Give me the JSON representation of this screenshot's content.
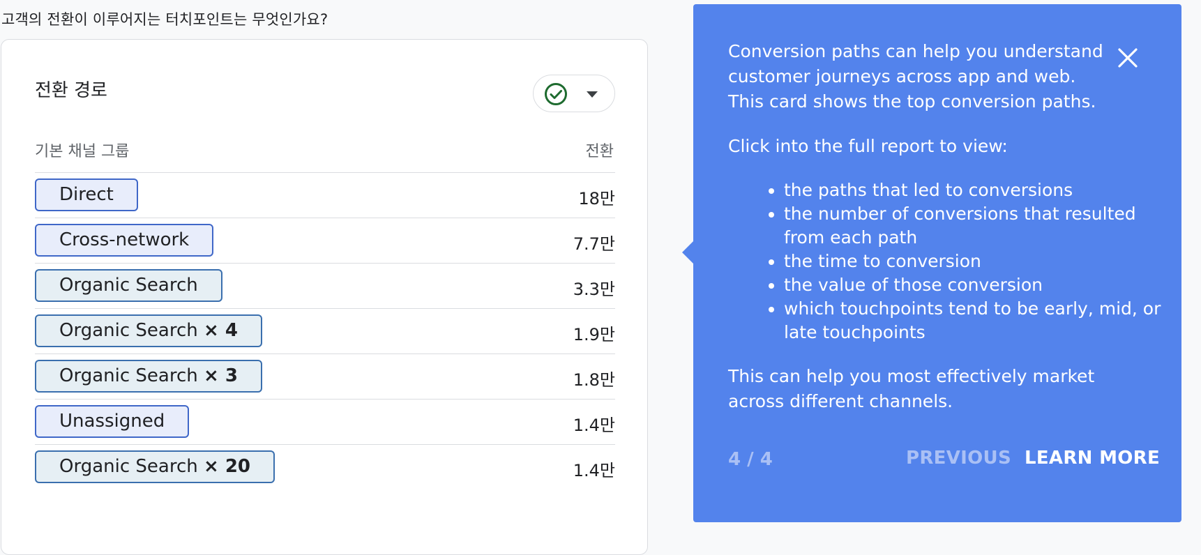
{
  "question": "고객의 전환이 이루어지는 터치포인트는 무엇인가요?",
  "card": {
    "title": "전환 경로",
    "status_icon": "check-circle-icon",
    "dropdown_icon": "caret-down-icon",
    "column_left": "기본 채널 그룹",
    "column_right": "전환",
    "rows": [
      {
        "label": "Direct",
        "mult": "",
        "value": "18만"
      },
      {
        "label": "Cross-network",
        "mult": "",
        "value": "7.7만"
      },
      {
        "label": "Organic Search",
        "mult": "",
        "value": "3.3만"
      },
      {
        "label": "Organic Search",
        "mult": "× 4",
        "value": "1.9만"
      },
      {
        "label": "Organic Search",
        "mult": "× 3",
        "value": "1.8만"
      },
      {
        "label": "Unassigned",
        "mult": "",
        "value": "1.4만"
      },
      {
        "label": "Organic Search",
        "mult": "× 20",
        "value": "1.4만"
      }
    ]
  },
  "tooltip": {
    "intro_1": "Conversion paths can help you understand",
    "intro_2": "customer journeys across app and web.",
    "intro_3": "This card shows the top conversion paths.",
    "lead": "Click into the full report to view:",
    "bullets": [
      "the paths that led to conversions",
      "the number of conversions that resulted from each path",
      "the time to conversion",
      "the value of those conversion",
      "which touchpoints tend to be early, mid, or late touchpoints"
    ],
    "outro_1": "This can help you most effectively market",
    "outro_2": "across different channels.",
    "step": "4 / 4",
    "previous_label": "PREVIOUS",
    "learn_more_label": "LEARN MORE",
    "close_icon": "close-icon"
  },
  "colors": {
    "tooltip_bg": "#5383ec",
    "chip_border": "#3f67c8",
    "check_green": "#1e6b2f"
  }
}
